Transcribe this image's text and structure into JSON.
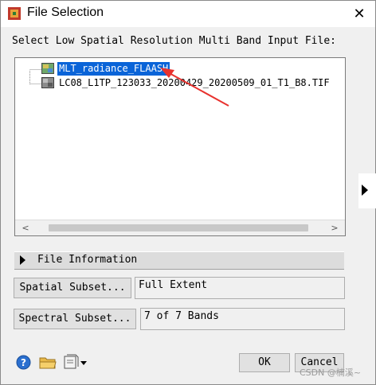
{
  "window": {
    "title": "File Selection",
    "close_glyph": "✕"
  },
  "prompt": "Select Low Spatial Resolution Multi Band Input File:",
  "files": [
    {
      "label": "MLT_radiance_FLAASH",
      "selected": true,
      "icon": "raster-multiband-icon"
    },
    {
      "label": "LC08_L1TP_123033_20200429_20200509_01_T1_B8.TIF",
      "selected": false,
      "icon": "raster-grayscale-icon"
    }
  ],
  "scrollbar": {
    "left_arrow": "<",
    "right_arrow": ">"
  },
  "file_information": {
    "label": "File Information"
  },
  "spatial_subset": {
    "button_label": "Spatial Subset...",
    "value": "Full Extent"
  },
  "spectral_subset": {
    "button_label": "Spectral Subset...",
    "value": "7 of 7 Bands"
  },
  "buttons": {
    "ok": "OK",
    "cancel": "Cancel"
  },
  "watermark": "CSDN @楠溪~",
  "colors": {
    "selection": "#0a64d8",
    "annotation_arrow": "#e8322e",
    "window_bg": "#f0f0f0"
  }
}
